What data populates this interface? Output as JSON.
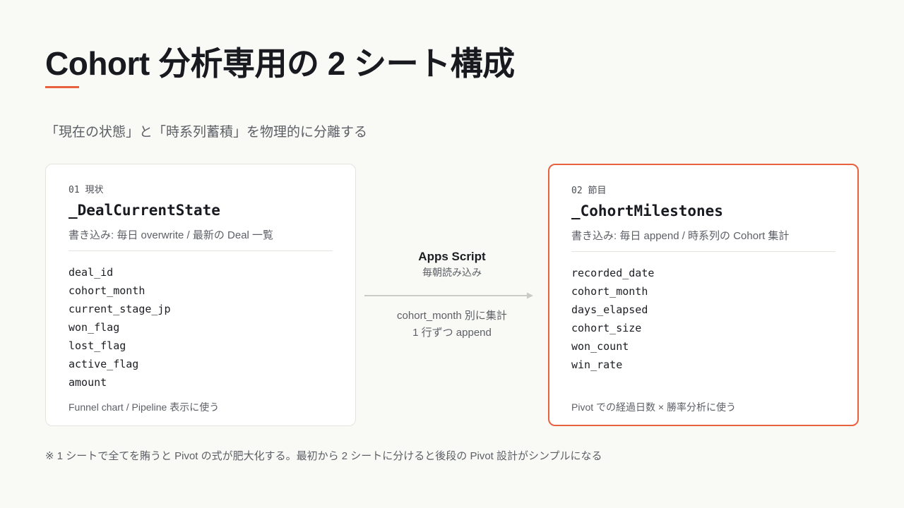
{
  "title": "Cohort 分析専用の 2 シート構成",
  "subtitle": "「現在の状態」と「時系列蓄積」を物理的に分離する",
  "colors": {
    "accent": "#e8613f",
    "background": "#f9f9f5",
    "text": "#1b1d22",
    "muted": "#5c5f66"
  },
  "left_card": {
    "number": "01 現状",
    "sheet_name": "_DealCurrentState",
    "description": "書き込み: 毎日 overwrite / 最新の Deal 一覧",
    "fields": [
      "deal_id",
      "cohort_month",
      "current_stage_jp",
      "won_flag",
      "lost_flag",
      "active_flag",
      "amount"
    ],
    "footer": "Funnel chart / Pipeline 表示に使う"
  },
  "flow": {
    "title": "Apps Script",
    "subtitle": "毎朝読み込み",
    "note_line1": "cohort_month 別に集計",
    "note_line2": "1 行ずつ append",
    "arrow_icon": "arrow-right-icon"
  },
  "right_card": {
    "number": "02 節目",
    "sheet_name": "_CohortMilestones",
    "description": "書き込み: 毎日 append / 時系列の Cohort 集計",
    "fields": [
      "recorded_date",
      "cohort_month",
      "days_elapsed",
      "cohort_size",
      "won_count",
      "win_rate"
    ],
    "footer": "Pivot での経過日数 × 勝率分析に使う"
  },
  "footnote": "※ 1 シートで全てを賄うと Pivot の式が肥大化する。最初から 2 シートに分けると後段の Pivot 設計がシンプルになる"
}
